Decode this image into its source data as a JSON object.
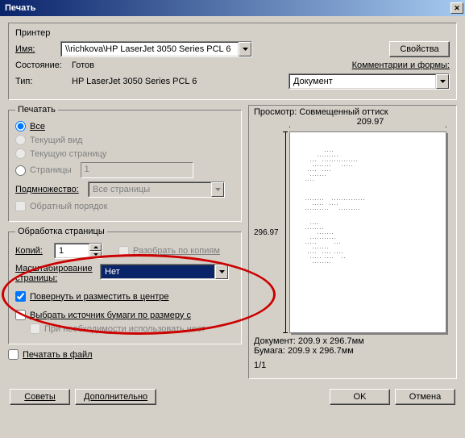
{
  "title": "Печать",
  "printer": {
    "section": "Принтер",
    "name_label": "Имя:",
    "name_value": "\\\\richkova\\HP LaserJet 3050 Series PCL 6",
    "props_btn": "Свойства",
    "state_label": "Состояние:",
    "state_value": "Готов",
    "type_label": "Тип:",
    "type_value": "HP LaserJet 3050 Series PCL 6",
    "comments_label": "Комментарии и формы:",
    "comments_value": "Документ"
  },
  "range": {
    "legend": "Печатать",
    "all": "Все",
    "current_view": "Текущий вид",
    "current_page": "Текущую страницу",
    "pages": "Страницы",
    "pages_value": "1",
    "subset_label": "Подмножество:",
    "subset_value": "Все страницы",
    "reverse": "Обратный порядок"
  },
  "handling": {
    "legend": "Обработка страницы",
    "copies_label": "Копий:",
    "copies_value": "1",
    "collate": "Разобрать по копиям",
    "scale_label": "Масштабирование страницы:",
    "scale_value": "Нет",
    "rotate": "Повернуть и разместить в центре",
    "paper_source": "Выбрать источник бумаги по размеру с",
    "use_custom": "При необходимости использовать нест"
  },
  "print_to_file": "Печатать в файл",
  "preview": {
    "label": "Просмотр: Совмещенный оттиск",
    "width": "209.97",
    "height": "296.97",
    "doc_label": "Документ:",
    "doc_value": "209.9 x 296.7мм",
    "paper_label": "Бумага:",
    "paper_value": "209.9 x 296.7мм",
    "page_of": "1/1"
  },
  "buttons": {
    "tips": "Советы",
    "advanced": "Дополнительно",
    "ok": "OK",
    "cancel": "Отмена"
  }
}
